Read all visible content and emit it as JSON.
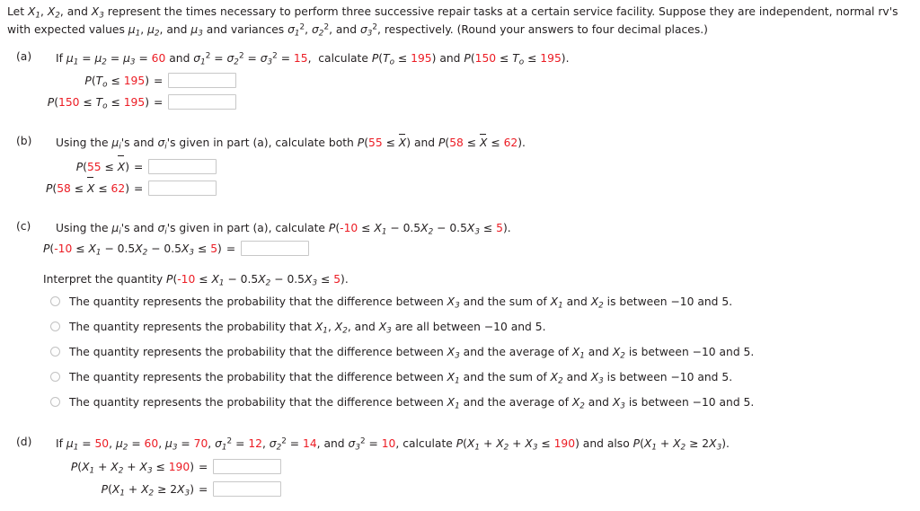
{
  "intro": {
    "line1_pre": "Let ",
    "line1_mid": " represent the times necessary to perform three successive repair tasks at a certain service facility. Suppose they are independent, normal rv's",
    "line2_pre": "with expected values ",
    "line2_mid": " and variances ",
    "line2_post": ", respectively. (Round your answers to four decimal places.)",
    "vars": [
      "X",
      "X",
      "X"
    ],
    "var_subs": [
      "1",
      "2",
      "3"
    ],
    "mus": [
      "μ",
      "μ",
      "μ"
    ],
    "sigmas": [
      "σ",
      "σ",
      "σ"
    ]
  },
  "parts": {
    "a": {
      "label": "(a)",
      "prompt_pre": "If ",
      "mu_eq": "μ",
      "mu_value": "60",
      "sigma_value": "15",
      "and_text": "and",
      "calc_text": "calculate",
      "p1_display": "P(T",
      "p1_sub": "o",
      "p1_rest": " ≤ 195)",
      "p1_value": "195",
      "p2_lower": "150",
      "p2_upper": "195",
      "tail": "and",
      "row1_label_prefix": "P(T",
      "row2_label_prefix": "P(",
      "answer1": "",
      "answer2": ""
    },
    "b": {
      "label": "(b)",
      "prompt_pre": "Using the ",
      "mu_sym": "μ",
      "sub_i": "i",
      "prompt_mid": "'s and ",
      "sigma_sym": "σ",
      "prompt_mid2": "'s given in part (a), calculate both ",
      "prompt_and": " and ",
      "prompt_end": ".",
      "p1_lower": "55",
      "p2_lower": "58",
      "p2_upper": "62",
      "xbar": "X",
      "answer1": "",
      "answer2": ""
    },
    "c": {
      "label": "(c)",
      "prompt_pre": "Using the ",
      "prompt_mid2": "'s given in part (a), calculate ",
      "prompt_end": ".",
      "lower": "-10",
      "upper": "5",
      "coef": "0.5",
      "interpret_pre": "Interpret the quantity ",
      "interpret_end": ".",
      "answer1": "",
      "options": [
        {
          "id": "option-1",
          "pre": "The quantity represents the probability that the difference between ",
          "v1": "X",
          "v1s": "3",
          "mid": " and the sum of ",
          "v2": "X",
          "v2s": "1",
          "mid2": " and ",
          "v3": "X",
          "v3s": "2",
          "post": " is between −10 and 5.",
          "selected": false
        },
        {
          "id": "option-2",
          "pre": "The quantity represents the probability that ",
          "v1": "X",
          "v1s": "1",
          "mid": ", ",
          "v2": "X",
          "v2s": "2",
          "mid2": ", and ",
          "v3": "X",
          "v3s": "3",
          "post": " are all between −10 and 5.",
          "selected": false
        },
        {
          "id": "option-3",
          "pre": "The quantity represents the probability that the difference between ",
          "v1": "X",
          "v1s": "3",
          "mid": " and the average of ",
          "v2": "X",
          "v2s": "1",
          "mid2": " and ",
          "v3": "X",
          "v3s": "2",
          "post": " is between −10 and 5.",
          "selected": false
        },
        {
          "id": "option-4",
          "pre": "The quantity represents the probability that the difference between ",
          "v1": "X",
          "v1s": "1",
          "mid": " and the sum of ",
          "v2": "X",
          "v2s": "2",
          "mid2": " and ",
          "v3": "X",
          "v3s": "3",
          "post": " is between −10 and 5.",
          "selected": false
        },
        {
          "id": "option-5",
          "pre": "The quantity represents the probability that the difference between ",
          "v1": "X",
          "v1s": "1",
          "mid": " and the average of ",
          "v2": "X",
          "v2s": "2",
          "mid2": " and ",
          "v3": "X",
          "v3s": "3",
          "post": " is between −10 and 5.",
          "selected": false
        }
      ]
    },
    "d": {
      "label": "(d)",
      "prompt_pre": "If ",
      "mu1": "50",
      "mu2": "60",
      "mu3": "70",
      "s1": "12",
      "s2": "14",
      "s3": "10",
      "calc_text": "calculate",
      "and_also": "and also",
      "sum_limit": "190",
      "coef2": "2",
      "answer1": "",
      "answer2": ""
    }
  },
  "colors": {
    "red": "#ec1c24",
    "text": "#231f20",
    "box_border": "#c8c8c8",
    "radio_border": "#c2c2c2",
    "background": "#ffffff"
  }
}
